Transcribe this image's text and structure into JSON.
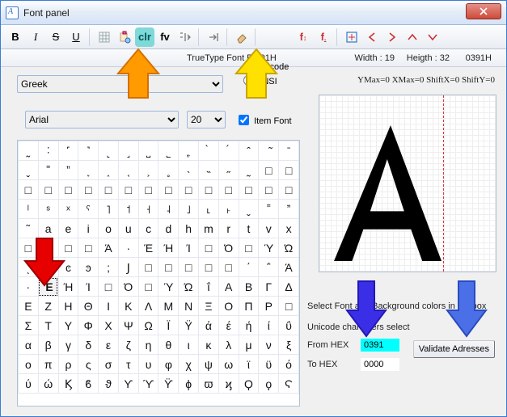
{
  "window": {
    "title": "Font panel",
    "close_label": "Close"
  },
  "toolbar": {
    "bold": "B",
    "italic": "I",
    "strike": "S",
    "underline": "U",
    "clr_label": "clr",
    "fv_label": "fv"
  },
  "info": {
    "truetype": "TrueType Font Ed  91H",
    "width": "Width : 19",
    "height": "Heigth : 32",
    "hexcode": "0391H"
  },
  "ymax_line": "YMax=0  XMax=0  ShiftX=0  ShiftY=0",
  "subset": {
    "selected": "Greek",
    "radio1": "Unicode",
    "radio2": "ANSI"
  },
  "fontrow": {
    "family": "Arial",
    "size": "20",
    "itemfont_label": "Item Font"
  },
  "chargrid_rows": [
    [
      "ͺ",
      "ͻ",
      "ͼ",
      "ͽ",
      ";",
      "Ϳ",
      "□",
      "□",
      "□",
      "□",
      "□",
      "΄",
      "΅",
      "Ά"
    ],
    [
      "·",
      "Έ",
      "Ή",
      "Ί",
      "□",
      "Ό",
      "□",
      "Ύ",
      "Ώ",
      "ΐ",
      "Α",
      "Β",
      "Γ",
      "Δ"
    ],
    [
      "Ε",
      "Ζ",
      "Η",
      "Θ",
      "Ι",
      "Κ",
      "Λ",
      "Μ",
      "Ν",
      "Ξ",
      "Ο",
      "Π",
      "Ρ",
      "□"
    ],
    [
      "Σ",
      "Τ",
      "Υ",
      "Φ",
      "Χ",
      "Ψ",
      "Ω",
      "Ϊ",
      "Ϋ",
      "ά",
      "έ",
      "ή",
      "ί",
      "ΰ"
    ],
    [
      "α",
      "β",
      "γ",
      "δ",
      "ε",
      "ζ",
      "η",
      "θ",
      "ι",
      "κ",
      "λ",
      "μ",
      "ν",
      "ξ"
    ],
    [
      "ο",
      "π",
      "ρ",
      "ς",
      "σ",
      "τ",
      "υ",
      "φ",
      "χ",
      "ψ",
      "ω",
      "ϊ",
      "ϋ",
      "ό"
    ],
    [
      "ύ",
      "ώ",
      "Ϗ",
      "ϐ",
      "ϑ",
      "ϒ",
      "ϓ",
      "ϔ",
      "ϕ",
      "ϖ",
      "ϗ",
      "Ϙ",
      "ϙ",
      "Ϛ"
    ]
  ],
  "preglyphrows": [
    [
      "˷",
      "˸",
      "˹",
      "˺",
      "˻",
      "˼",
      "˽",
      "˾",
      "˿",
      "̀",
      "́",
      "̂",
      "̃",
      "̄"
    ],
    [
      "ˬ",
      "˭",
      "ˮ",
      "˯",
      "˰",
      "˱",
      "˲",
      "˳",
      "˴",
      "˵",
      "˶",
      "˷",
      "□",
      "□"
    ],
    [
      "□",
      "□",
      "□",
      "□",
      "□",
      "□",
      "□",
      "□",
      "□",
      "□",
      "□",
      "□",
      "□",
      "□"
    ],
    [
      "ˡ",
      "ˢ",
      "ˣ",
      "ˤ",
      "˥",
      "˦",
      "˧",
      "˨",
      "˩",
      "˪",
      "˫",
      "ˬ",
      "˭",
      "ˮ"
    ],
    [
      "˜",
      "a",
      "e",
      "i",
      "o",
      "u",
      "c",
      "d",
      "h",
      "m",
      "r",
      "t",
      "v",
      "x"
    ],
    [
      "□",
      "□",
      "□",
      "□",
      "Ά",
      "·",
      "Έ",
      "Ή",
      "Ί",
      "□",
      "Ό",
      "□",
      "Ύ",
      "Ώ"
    ]
  ],
  "selcolors": {
    "line1": "Select Font and Background colors in toolbox",
    "line2": "Unicode characters select",
    "fromhex_label": "From HEX",
    "fromhex_value": "0391",
    "tohex_label": "To HEX",
    "tohex_value": "0000",
    "validate_label": "Validate Adresses"
  },
  "selected_cell": {
    "row": 1,
    "col": 1
  },
  "preview_glyph": "Α"
}
